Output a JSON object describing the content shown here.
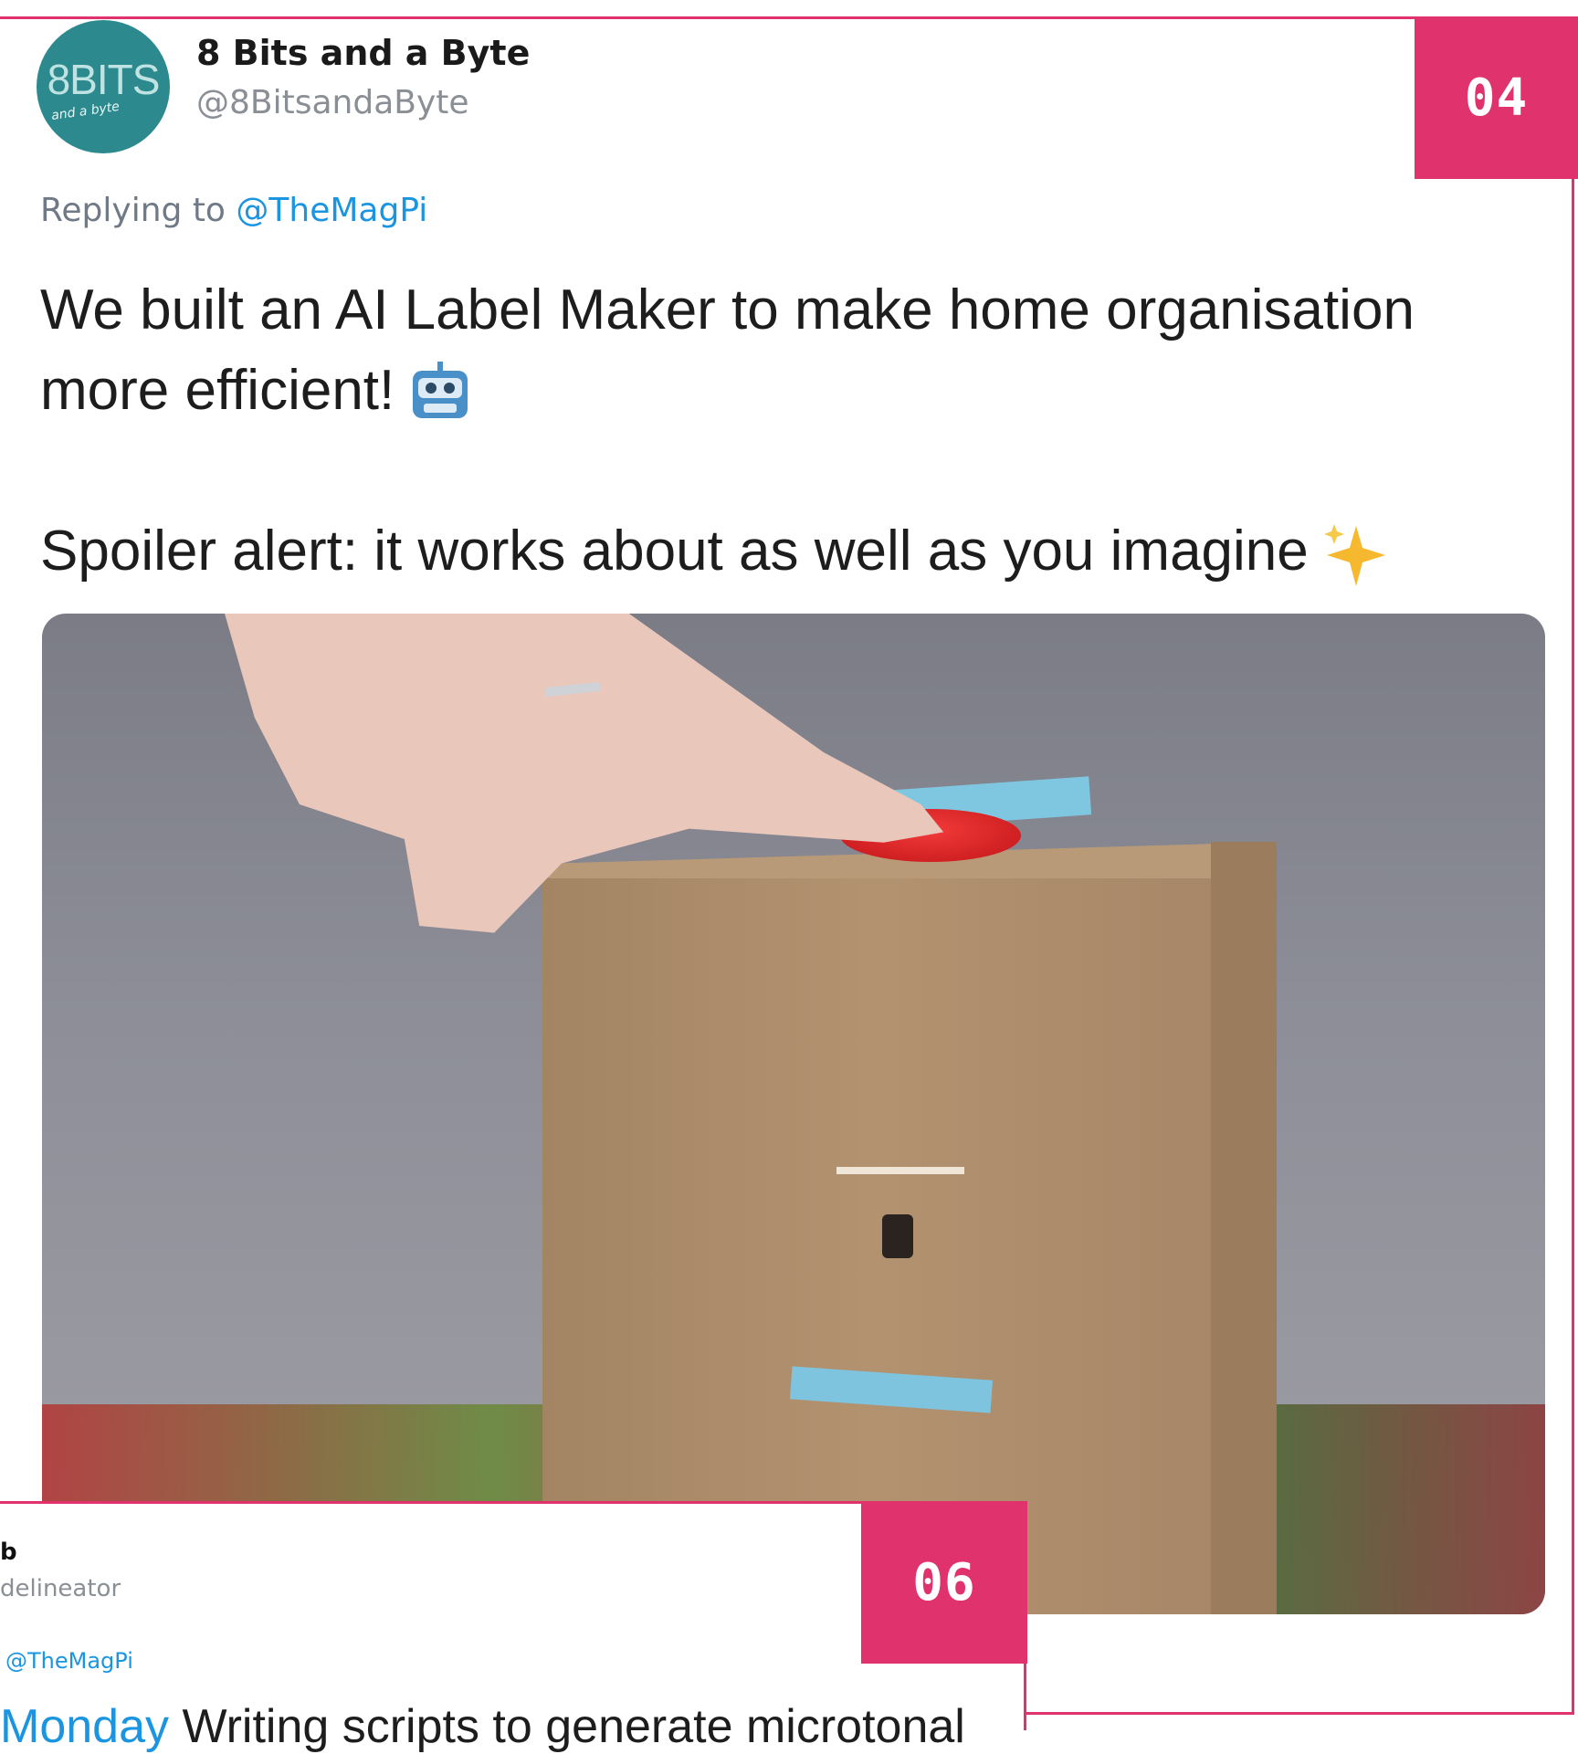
{
  "tweet_main": {
    "author_name": "8 Bits and a Byte",
    "author_handle": "@8BitsandaByte",
    "avatar": {
      "logo_text": "8BITS",
      "logo_subtext": "and a byte"
    },
    "replying_prefix": "Replying to ",
    "replying_handle": "@TheMagPi",
    "text_line_1": "We built an AI Label Maker to make home organisation more efficient!",
    "emoji_1": "robot-face",
    "text_line_2": "Spoiler alert: it works about as well as you imagine",
    "emoji_2": "sparkles",
    "media": "photo: hand pressing red button on cardboard box label maker"
  },
  "badges": {
    "first": "04",
    "second": "06"
  },
  "tweet_second": {
    "author_name_partial": "b",
    "handle_partial": "delineator",
    "replying_handle": "@TheMagPi",
    "text_day": "Monday",
    "text_rest": " Writing scripts to generate microtonal"
  },
  "colors": {
    "accent": "#e0336e",
    "link": "#1b95e0"
  }
}
